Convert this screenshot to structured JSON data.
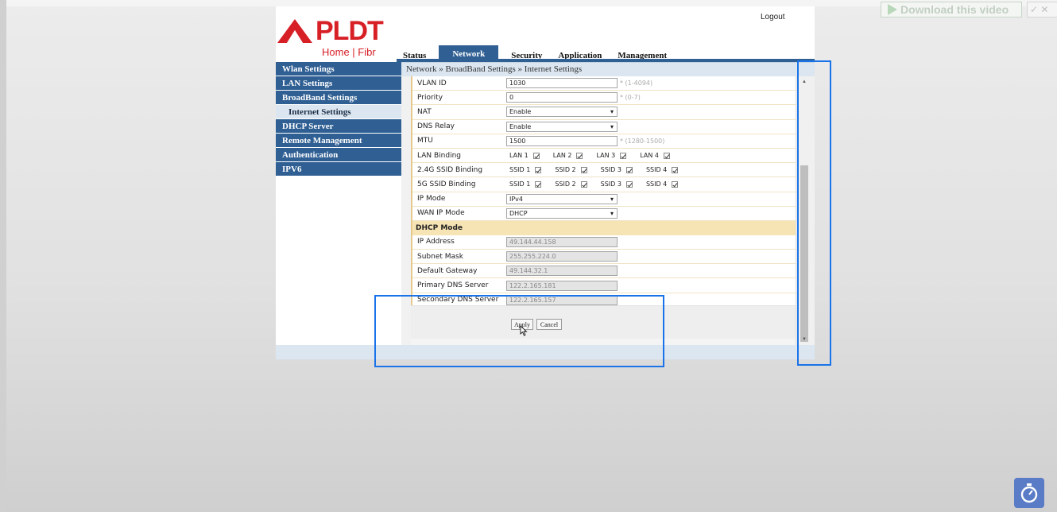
{
  "overlay": {
    "download_label": "Download this video",
    "mini_label": "✓ ✕"
  },
  "brand": {
    "name": "PLDT",
    "tagline": "Home | Fibr",
    "color": "#d71f26"
  },
  "header": {
    "logout": "Logout"
  },
  "tabs": [
    {
      "label": "Status",
      "active": false
    },
    {
      "label": "Network",
      "active": true
    },
    {
      "label": "Security",
      "active": false
    },
    {
      "label": "Application",
      "active": false
    },
    {
      "label": "Management",
      "active": false
    }
  ],
  "sidebar": {
    "items": [
      {
        "label": "Wlan Settings"
      },
      {
        "label": "LAN Settings"
      },
      {
        "label": "BroadBand Settings"
      },
      {
        "label": "Internet Settings"
      },
      {
        "label": "DHCP Server"
      },
      {
        "label": "Remote Management"
      },
      {
        "label": "Authentication"
      },
      {
        "label": "IPV6"
      }
    ]
  },
  "breadcrumb": "Network » BroadBand Settings » Internet Settings",
  "form": {
    "vlan_id": {
      "label": "VLAN ID",
      "value": "1030",
      "hint": "* (1-4094)"
    },
    "priority": {
      "label": "Priority",
      "value": "0",
      "hint": "* (0-7)"
    },
    "nat": {
      "label": "NAT",
      "value": "Enable"
    },
    "dns_relay": {
      "label": "DNS Relay",
      "value": "Enable"
    },
    "mtu": {
      "label": "MTU",
      "value": "1500",
      "hint": "* (1280-1500)"
    },
    "lan_binding": {
      "label": "LAN Binding",
      "options": [
        "LAN 1",
        "LAN 2",
        "LAN 3",
        "LAN 4"
      ]
    },
    "ssid24_binding": {
      "label": "2.4G SSID Binding",
      "options": [
        "SSID 1",
        "SSID 2",
        "SSID 3",
        "SSID 4"
      ]
    },
    "ssid5_binding": {
      "label": "5G SSID Binding",
      "options": [
        "SSID 1",
        "SSID 2",
        "SSID 3",
        "SSID 4"
      ]
    },
    "ip_mode": {
      "label": "IP Mode",
      "value": "IPv4"
    },
    "wan_ip_mode": {
      "label": "WAN IP Mode",
      "value": "DHCP"
    },
    "dhcp_section": "DHCP Mode",
    "ip_address": {
      "label": "IP Address",
      "value": "49.144.44.158"
    },
    "subnet_mask": {
      "label": "Subnet Mask",
      "value": "255.255.224.0"
    },
    "default_gateway": {
      "label": "Default Gateway",
      "value": "49.144.32.1"
    },
    "primary_dns": {
      "label": "Primary DNS Server",
      "value": "122.2.165.181"
    },
    "secondary_dns": {
      "label": "Secondary DNS Server",
      "value": "122.2.165.157"
    },
    "apply": "Apply",
    "cancel": "Cancel"
  },
  "colors": {
    "nav_blue": "#2f5f93",
    "highlight": "#1a73e8",
    "section_bg": "#f7e4b4"
  }
}
